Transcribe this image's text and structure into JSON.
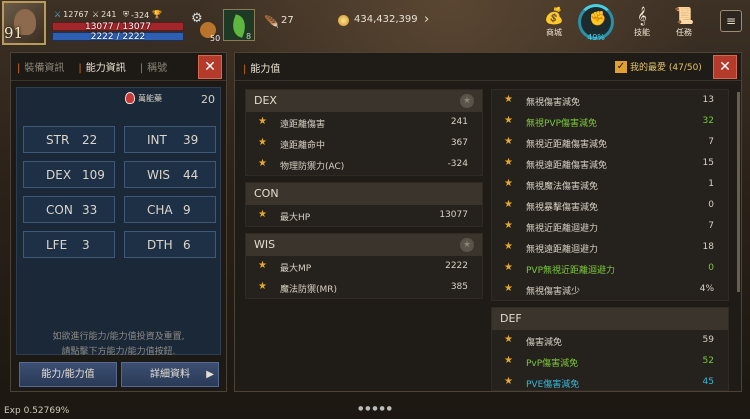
{
  "hud": {
    "level": "91",
    "stat1": "12767",
    "stat2": "241",
    "stat3": "-324",
    "hp": "13077 / 13077",
    "mp": "2222 / 2222",
    "potion_count": "50",
    "leaf_count": "8",
    "feather_count": "27",
    "gold": "434,432,399",
    "shop_label": "商城",
    "ring_pct": "49%",
    "skill_label": "技能",
    "quest_label": "任務"
  },
  "left_panel": {
    "tabs": [
      "裝備資訊",
      "能力資訊",
      "稱號"
    ],
    "elixir_label": "萬能藥",
    "elixir_value": "20",
    "stats": [
      {
        "k": "STR",
        "v": "22"
      },
      {
        "k": "INT",
        "v": "39"
      },
      {
        "k": "DEX",
        "v": "109"
      },
      {
        "k": "WIS",
        "v": "44"
      },
      {
        "k": "CON",
        "v": "33"
      },
      {
        "k": "CHA",
        "v": "9"
      },
      {
        "k": "LFE",
        "v": "3"
      },
      {
        "k": "DTH",
        "v": "6"
      }
    ],
    "hint_line1": "如欲進行能力/能力值投資及重置,",
    "hint_line2": "請點擊下方能力/能力值按鈕.",
    "btn_stats": "能力/能力值",
    "btn_details": "詳細資料"
  },
  "right_panel": {
    "title": "能力值",
    "fav_label": "我的最愛 (47/50)",
    "dex": {
      "title": "DEX",
      "rows": [
        {
          "n": "遠距離傷害",
          "v": "241"
        },
        {
          "n": "遠距離命中",
          "v": "367"
        },
        {
          "n": "物理防禦力(AC)",
          "v": "-324"
        }
      ]
    },
    "con": {
      "title": "CON",
      "rows": [
        {
          "n": "最大HP",
          "v": "13077"
        }
      ]
    },
    "wis": {
      "title": "WIS",
      "rows": [
        {
          "n": "最大MP",
          "v": "2222"
        },
        {
          "n": "魔法防禦(MR)",
          "v": "385"
        }
      ]
    },
    "misc": {
      "rows": [
        {
          "n": "無視傷害減免",
          "v": "13"
        },
        {
          "n": "無視PVP傷害減免",
          "v": "32"
        },
        {
          "n": "無視近距離傷害減免",
          "v": "7"
        },
        {
          "n": "無視遠距離傷害減免",
          "v": "15"
        },
        {
          "n": "無視魔法傷害減免",
          "v": "1"
        },
        {
          "n": "無視暴擊傷害減免",
          "v": "0"
        },
        {
          "n": "無視近距離迴避力",
          "v": "7"
        },
        {
          "n": "無視遠距離迴避力",
          "v": "18"
        },
        {
          "n": "PVP無視近距離迴避力",
          "v": "0"
        },
        {
          "n": "無視傷害減少",
          "v": "4%"
        }
      ]
    },
    "def": {
      "title": "DEF",
      "rows": [
        {
          "n": "傷害減免",
          "v": "59"
        },
        {
          "n": "PvP傷害減免",
          "v": "52"
        },
        {
          "n": "PVE傷害減免",
          "v": "45"
        }
      ]
    }
  },
  "footer": {
    "exp": "Exp 0.52769%"
  }
}
